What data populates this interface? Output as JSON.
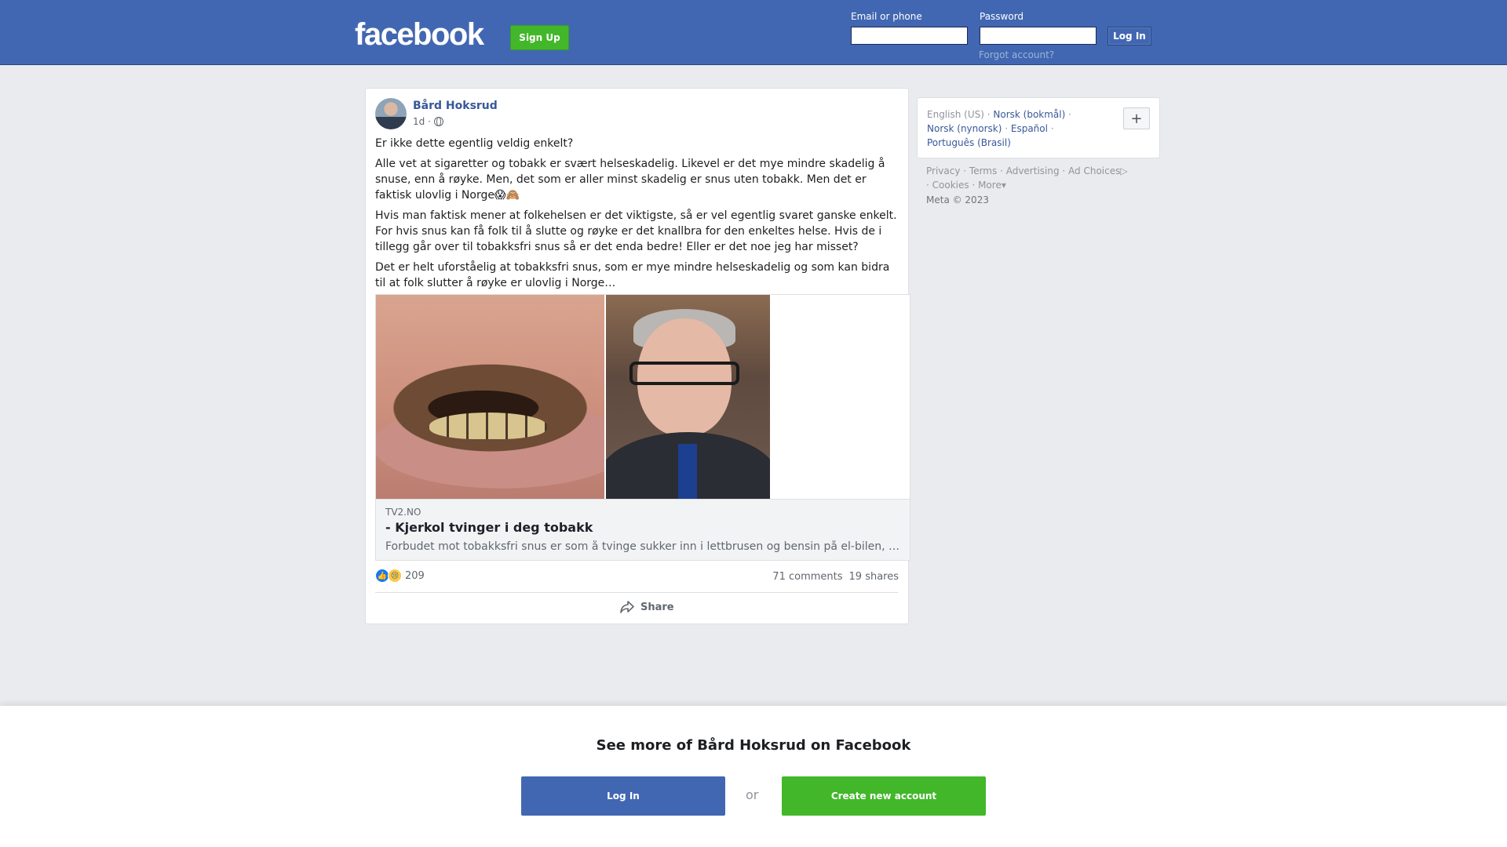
{
  "header": {
    "logo": "facebook",
    "signup_label": "Sign Up",
    "email_label": "Email or phone",
    "password_label": "Password",
    "login_label": "Log In",
    "forgot_label": "Forgot account?"
  },
  "post": {
    "author": "Bård Hoksrud",
    "time": "1d ·",
    "paragraphs": [
      "Er ikke dette egentlig veldig enkelt?",
      "Alle vet at sigaretter og tobakk er svært helseskadelig. Likevel er det mye mindre skadelig å snuse, enn å røyke. Men, det som er aller minst skadelig er snus uten tobakk. Men det er faktisk ulovlig i Norge😱🙈",
      "Hvis man faktisk mener at folkehelsen er det viktigste, så er vel egentlig svaret ganske enkelt. For hvis snus kan få folk til å slutte og røyke er det knallbra for den enkeltes helse. Hvis de i tillegg går over til tobakksfri snus så er det enda bedre! Eller er det noe jeg har misset?",
      "Det er helt uforståelig at tobakksfri snus, som er mye mindre helseskadelig og som kan bidra til at folk slutter å røyke er ulovlig i Norge…"
    ],
    "link": {
      "domain": "TV2.NO",
      "title": "- Kjerkol tvinger i deg tobakk",
      "description": "Forbudet mot tobakksfri snus er som å tvinge sukker inn i lettbrusen og bensin på el-bilen, mener Frp-profil."
    },
    "reaction_count": "209",
    "comments": "71 comments",
    "shares": "19 shares",
    "share_label": "Share"
  },
  "sidebar": {
    "languages": [
      "English (US)",
      "Norsk (bokmål)",
      "Norsk (nynorsk)",
      "Español",
      "Português (Brasil)"
    ],
    "footer_links": [
      "Privacy",
      "Terms",
      "Advertising",
      "Ad Choices",
      "Cookies",
      "More"
    ],
    "copyright": "Meta © 2023"
  },
  "overlay": {
    "title": "See more of Bård Hoksrud on Facebook",
    "login_label": "Log In",
    "or_label": "or",
    "create_label": "Create new account"
  },
  "colors": {
    "brand": "#4267b2",
    "green": "#42b72a",
    "link": "#385898",
    "background": "#e9ebee"
  }
}
